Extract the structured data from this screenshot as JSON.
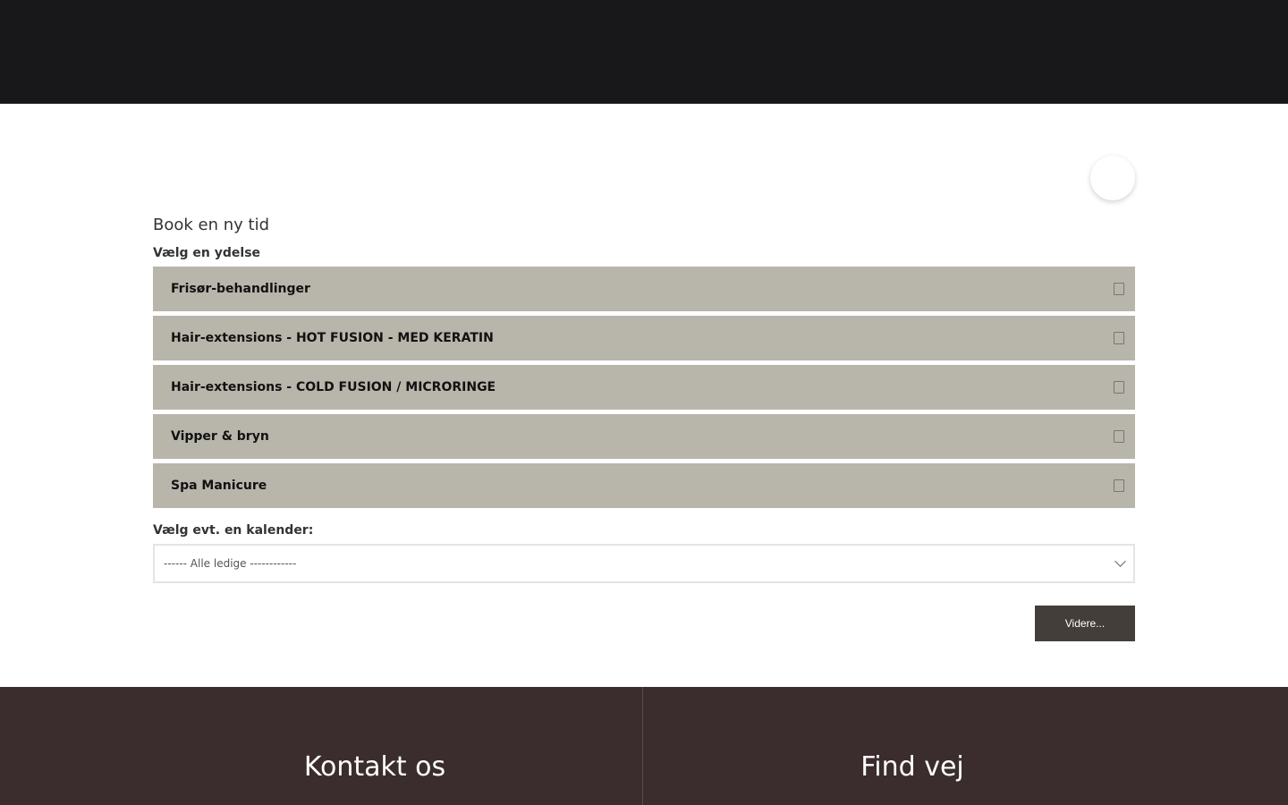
{
  "booking": {
    "icon_button": "",
    "title": "Book en ny tid",
    "service_label": "Vælg en ydelse",
    "services": [
      {
        "name": "Frisør-behandlinger",
        "chevron": ""
      },
      {
        "name": "Hair-extensions - HOT FUSION - MED KERATIN",
        "chevron": ""
      },
      {
        "name": "Hair-extensions - COLD FUSION / MICRORINGE",
        "chevron": ""
      },
      {
        "name": "Vipper & bryn",
        "chevron": ""
      },
      {
        "name": "Spa Manicure",
        "chevron": ""
      }
    ],
    "calendar_label": "Vælg evt. en kalender:",
    "calendar_selected": "------ Alle ledige ------------",
    "next_label": "Videre..."
  },
  "footer": {
    "contact_heading": "Kontakt os",
    "directions_heading": "Find vej"
  },
  "colors": {
    "top_bar": "#18181a",
    "service_bg": "#b8b5ab",
    "button_bg": "#433e39",
    "footer_bg": "#3b2d2d"
  }
}
